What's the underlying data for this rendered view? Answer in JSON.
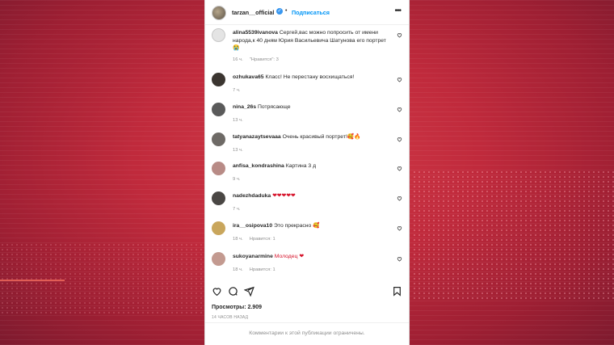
{
  "header": {
    "username": "tarzan__official",
    "verified_icon": "verified-badge-icon",
    "separator": "•",
    "follow_label": "Подписаться",
    "more_icon": "more-options-icon"
  },
  "comments": [
    {
      "user": "alina5539ivanova",
      "text": "Сергей,вас можно попросить от имени народа,к 40 дням Юрия Васильевича Шатунова его портрет 😭",
      "time": "16 ч.",
      "likes": "\"Нравится\": 3",
      "avatar_color": "#e4e4e4"
    },
    {
      "user": "ozhukava65",
      "text": "Класс! Не перестану восхищаться!",
      "time": "7 ч.",
      "likes": "",
      "avatar_color": "#3b3530"
    },
    {
      "user": "nina_26s",
      "text": "Потрясающе",
      "time": "13 ч.",
      "likes": "",
      "avatar_color": "#5a5a5a"
    },
    {
      "user": "tatyanazaytsevaaa",
      "text": "Очень красивый портрет!🥰🔥",
      "time": "13 ч.",
      "likes": "",
      "avatar_color": "#6e6a66"
    },
    {
      "user": "anfisa_kondrashina",
      "text": "Картина 3 д",
      "time": "9 ч.",
      "likes": "",
      "avatar_color": "#b88b86"
    },
    {
      "user": "nadezhdaduka",
      "text": "❤❤❤❤❤",
      "time": "7 ч.",
      "likes": "",
      "avatar_color": "#4a4744"
    },
    {
      "user": "ira__osipova10",
      "text": "Это прекрасно 🥰",
      "time": "18 ч.",
      "likes": "Нравится: 1",
      "avatar_color": "#c9a65c"
    },
    {
      "user": "sukoyanarmine",
      "text": "Молодец ❤",
      "time": "18 ч.",
      "likes": "Нравится: 1",
      "avatar_color": "#c39a90"
    }
  ],
  "actions": {
    "like_icon": "heart-icon",
    "comment_icon": "comment-icon",
    "share_icon": "share-icon",
    "save_icon": "bookmark-icon"
  },
  "post": {
    "likes": "Просмотры: 2.909",
    "time": "14 ЧАСОВ НАЗАД"
  },
  "footer": {
    "text": "Комментарии к этой публикации ограничены."
  }
}
